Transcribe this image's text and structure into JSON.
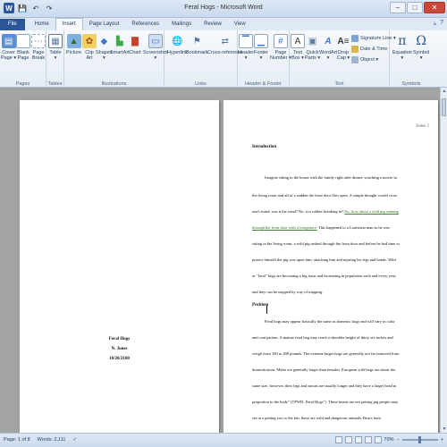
{
  "window": {
    "title": "Feral Hogs - Microsoft Word",
    "word_icon": "W",
    "controls": [
      "–",
      "□",
      "✕"
    ]
  },
  "qat": {
    "save": "💾",
    "undo": "↶",
    "redo": "↷"
  },
  "tabs": [
    "File",
    "Home",
    "Insert",
    "Page Layout",
    "References",
    "Mailings",
    "Review",
    "View"
  ],
  "active_tab": "Insert",
  "ribbon": {
    "pages": {
      "label": "Pages",
      "cover": "Cover\nPage ▾",
      "blank": "Blank\nPage",
      "break": "Page\nBreak"
    },
    "tables": {
      "label": "Tables",
      "table": "Table\n▾"
    },
    "illustrations": {
      "label": "Illustrations",
      "picture": "Picture",
      "clipart": "Clip\nArt",
      "shapes": "Shapes\n▾",
      "smartart": "SmartArt",
      "chart": "Chart",
      "screenshot": "Screenshot\n▾"
    },
    "links": {
      "label": "Links",
      "hyperlink": "Hyperlink",
      "bookmark": "Bookmark",
      "crossref": "Cross-reference"
    },
    "header_footer": {
      "label": "Header & Footer",
      "header": "Header\n▾",
      "footer": "Footer\n▾",
      "pagenumber": "Page\nNumber ▾"
    },
    "text": {
      "label": "Text",
      "textbox": "Text\nBox ▾",
      "quickparts": "Quick\nParts ▾",
      "wordart": "WordArt\n▾",
      "dropcap": "Drop\nCap ▾",
      "signature": "Signature Line ▾",
      "datetime": "Date & Time",
      "object": "Object ▾"
    },
    "symbols": {
      "label": "Symbols",
      "equation": "Equation\n▾",
      "symbol": "Symbol\n▾"
    }
  },
  "page1": {
    "title": "Feral Hogs",
    "author": "N. Jones",
    "date": "10/20/2100"
  },
  "page2": {
    "page_number": "Jones 2",
    "intro_heading": "Introduction",
    "intro_lines": [
      "Imagine sitting in the house with the family right after dinner, watching a movie in",
      "the living room and all of a sudden the front door flies open. A simple thought would cross",
      "one's mind, was it the wind? No, it is robber breaking in?",
      "through the front door with a vengeance.",
      "sitting in the living room, a wild pig rushed through the front door and before he had time to",
      "protect himself the pig was upon him, attacking him and injuring his legs and hands. Wild",
      "or \"feral\" hogs are becoming a big issue and increasing in population each and every year,",
      "and they can be stopped by way of trapping."
    ],
    "line3_highlight": "No, how about a wild pig running",
    "line4_rest": " This happened to a Louisiana man as he was",
    "problem_heading": "Problem",
    "problem_lines": [
      "Feral hogs may appear basically the same as domestic hogs and will vary in color",
      "and coat pattern. A mature feral hog may reach a shoulder height of thirty six inches and",
      "weigh from 100 to 400 pounds. The extreme larger hogs are generally not far removed from",
      "domestication. Males are generally larger than females. European wild hogs are about the",
      "same size, however, their legs and snouts are usually longer and they have a larger head in",
      "proportion to the body\" (TPWD: Feral Hogs\"). These beasts are not petting pig people may",
      "see at a petting zoo or the fair, these are wild and dangerous animals. Boars have"
    ]
  },
  "status": {
    "page": "Page: 1 of 8",
    "words": "Words: 2,111",
    "zoom": "70%"
  }
}
